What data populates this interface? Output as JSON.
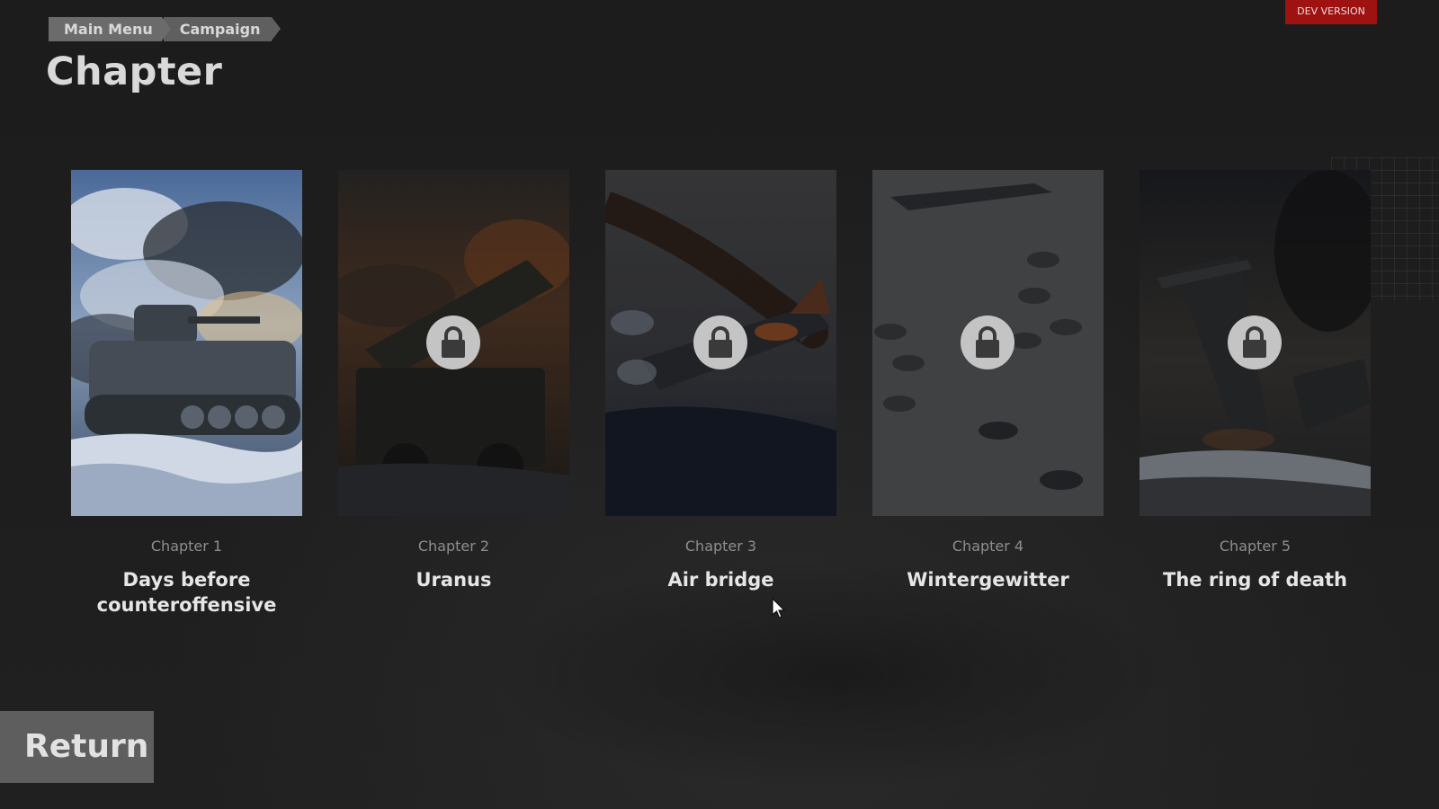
{
  "breadcrumb": {
    "items": [
      "Main Menu",
      "Campaign"
    ]
  },
  "page": {
    "title": "Chapter"
  },
  "badge": {
    "label": "DEV VERSION",
    "color": "#9e1212"
  },
  "chapters": [
    {
      "number": "Chapter 1",
      "title": "Days before counteroffensive",
      "locked": false
    },
    {
      "number": "Chapter 2",
      "title": "Uranus",
      "locked": true
    },
    {
      "number": "Chapter 3",
      "title": "Air bridge",
      "locked": true
    },
    {
      "number": "Chapter 4",
      "title": "Wintergewitter",
      "locked": true
    },
    {
      "number": "Chapter 5",
      "title": "The ring of death",
      "locked": true
    }
  ],
  "footer": {
    "return_label": "Return"
  },
  "icons": {
    "locked": "lock-icon",
    "cursor": "mouse-pointer-icon"
  }
}
